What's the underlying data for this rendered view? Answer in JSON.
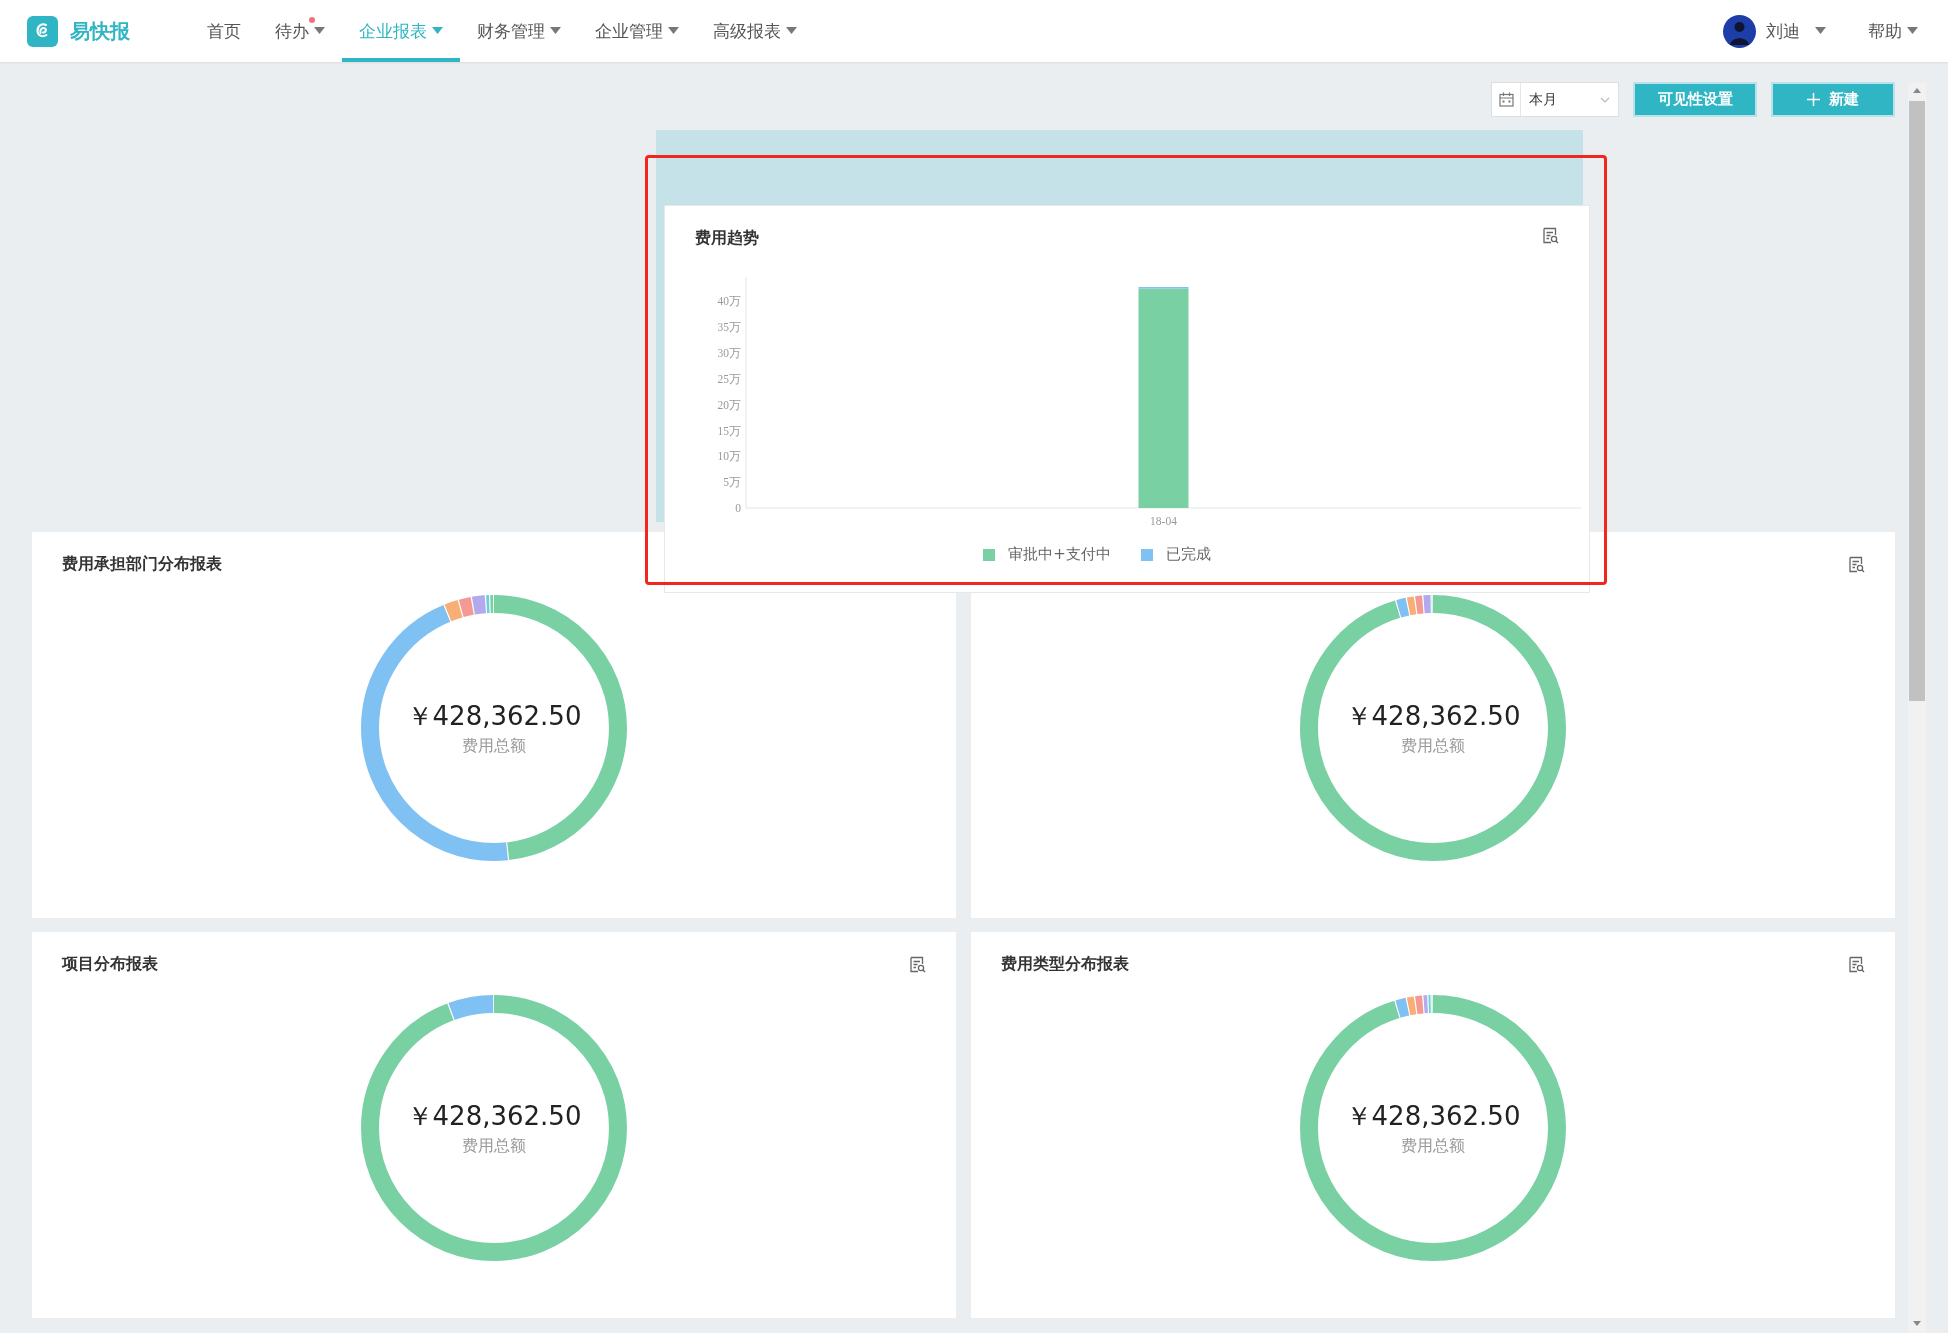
{
  "header": {
    "brand": "易快报",
    "nav": [
      {
        "label": "首页",
        "selected": false,
        "has_menu": false,
        "dot": false
      },
      {
        "label": "待办",
        "selected": false,
        "has_menu": true,
        "dot": true
      },
      {
        "label": "企业报表",
        "selected": true,
        "has_menu": true,
        "dot": false
      },
      {
        "label": "财务管理",
        "selected": false,
        "has_menu": true,
        "dot": false
      },
      {
        "label": "企业管理",
        "selected": false,
        "has_menu": true,
        "dot": false
      },
      {
        "label": "高级报表",
        "selected": false,
        "has_menu": true,
        "dot": false
      }
    ],
    "user": {
      "name": "刘迪"
    },
    "help": "帮助"
  },
  "toolbar": {
    "date_range": "本月",
    "buttons": [
      {
        "label": "可见性设置",
        "kind": "text"
      },
      {
        "label": "新建",
        "kind": "add"
      }
    ]
  },
  "dragged_card": {
    "title": "费用趋势",
    "chart_data": {
      "type": "bar",
      "stacked": true,
      "categories": [
        "18-04"
      ],
      "series": [
        {
          "name": "审批中+支付中",
          "color": "#78d0a3",
          "values": [
            42.5
          ]
        },
        {
          "name": "已完成",
          "color": "#7fc1f2",
          "values": [
            0.3
          ]
        }
      ],
      "ylim": [
        0,
        43
      ],
      "yticks": [
        {
          "value": 0,
          "label": "0"
        },
        {
          "value": 5,
          "label": "5万"
        },
        {
          "value": 10,
          "label": "10万"
        },
        {
          "value": 15,
          "label": "15万"
        },
        {
          "value": 20,
          "label": "20万"
        },
        {
          "value": 25,
          "label": "25万"
        },
        {
          "value": 30,
          "label": "30万"
        },
        {
          "value": 35,
          "label": "35万"
        },
        {
          "value": 40,
          "label": "40万"
        }
      ]
    }
  },
  "cards": [
    {
      "title": "费用承担部门分布报表",
      "amount": "￥428,362.50",
      "amount_label": "费用总额"
    },
    {
      "detail_button": true,
      "amount": "￥428,362.50",
      "amount_label": "费用总额"
    },
    {
      "title": "项目分布报表",
      "detail_button": true,
      "amount": "￥428,362.50",
      "amount_label": "费用总额"
    },
    {
      "title": "费用类型分布报表",
      "detail_button": true,
      "amount": "￥428,362.50",
      "amount_label": "费用总额"
    }
  ]
}
